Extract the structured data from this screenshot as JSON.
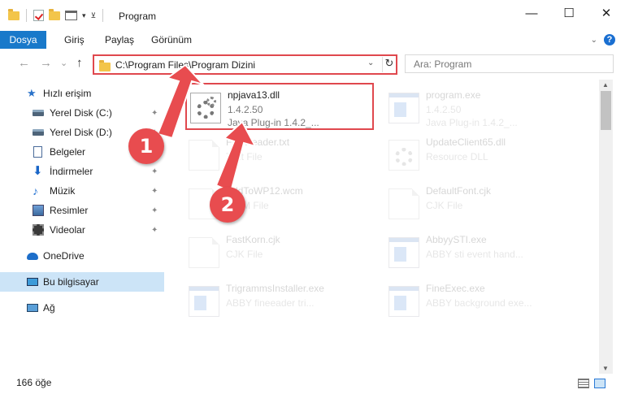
{
  "window": {
    "title": "Program",
    "minimize": "—",
    "maximize": "☐",
    "close": "✕"
  },
  "ribbon": {
    "tabs": [
      "Dosya",
      "Giriş",
      "Paylaş",
      "Görünüm"
    ],
    "help": "?"
  },
  "nav": {
    "back": "←",
    "forward": "→",
    "recent": "⌄",
    "up": "↑",
    "address": "C:\\Program Files\\Program Dizini",
    "refresh": "↻",
    "search_placeholder": "Ara: Program"
  },
  "sidebar": {
    "items": [
      {
        "label": "Hızlı erişim",
        "icon": "star-icon"
      },
      {
        "label": "Yerel Disk (C:)",
        "icon": "disk-icon",
        "pinned": true
      },
      {
        "label": "Yerel Disk (D:)",
        "icon": "disk-icon",
        "pinned": true
      },
      {
        "label": "Belgeler",
        "icon": "document-icon",
        "pinned": true
      },
      {
        "label": "İndirmeler",
        "icon": "download-icon",
        "pinned": true
      },
      {
        "label": "Müzik",
        "icon": "music-icon",
        "pinned": true
      },
      {
        "label": "Resimler",
        "icon": "pictures-icon",
        "pinned": true
      },
      {
        "label": "Videolar",
        "icon": "video-icon",
        "pinned": true
      },
      {
        "label": "OneDrive",
        "icon": "cloud-icon"
      },
      {
        "label": "Bu bilgisayar",
        "icon": "computer-icon",
        "selected": true
      },
      {
        "label": "Ağ",
        "icon": "network-icon"
      }
    ]
  },
  "files": [
    {
      "name": "npjava13.dll",
      "line1": "1.4.2.50",
      "line2": "Java Plug-in 1.4.2_...",
      "icon": "dll-gear-icon",
      "highlighted": true
    },
    {
      "name": "program.exe",
      "line1": "1.4.2.50",
      "line2": "Java Plug-in 1.4.2_...",
      "icon": "exe-icon"
    },
    {
      "name": "FineReader.txt",
      "line1": "Text File",
      "line2": "",
      "icon": "text-file-icon"
    },
    {
      "name": "UpdateClient65.dll",
      "line1": "Resource DLL",
      "line2": "",
      "icon": "dll-icon"
    },
    {
      "name": "AddToWP12.wcm",
      "line1": "WCM File",
      "line2": "",
      "icon": "file-icon"
    },
    {
      "name": "DefaultFont.cjk",
      "line1": "CJK File",
      "line2": "",
      "icon": "file-icon"
    },
    {
      "name": "FastKorn.cjk",
      "line1": "CJK File",
      "line2": "",
      "icon": "file-icon"
    },
    {
      "name": "AbbyySTI.exe",
      "line1": "ABBY sti event hand...",
      "line2": "",
      "icon": "exe-icon"
    },
    {
      "name": "TrigrammsInstaller.exe",
      "line1": "ABBY fineeader tri...",
      "line2": "",
      "icon": "exe-icon"
    },
    {
      "name": "FineExec.exe",
      "line1": "ABBY background exe...",
      "line2": "",
      "icon": "exe-icon"
    }
  ],
  "status": {
    "count": "166 öğe"
  },
  "callouts": [
    "1",
    "2"
  ],
  "colors": {
    "accent": "#1979ca",
    "highlight_border": "#e0484e",
    "callout": "#e84c4f",
    "selection": "#cce4f7"
  }
}
